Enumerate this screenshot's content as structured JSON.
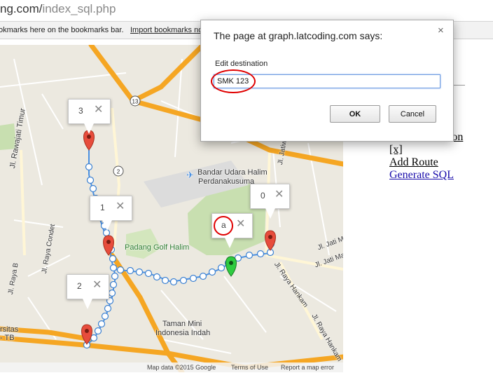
{
  "browser": {
    "url_domain": "ng.com/",
    "url_path": "index_sql.php",
    "bookmarks_message": "okmarks here on the bookmarks bar.",
    "import_link": "Import bookmarks no"
  },
  "map": {
    "markers": [
      {
        "label": "3",
        "color": "#e74c3c"
      },
      {
        "label": "1",
        "color": "#e74c3c"
      },
      {
        "label": "2",
        "color": "#e74c3c"
      },
      {
        "label": "0",
        "color": "#e74c3c"
      },
      {
        "label": "a",
        "color": "#2ecc40"
      }
    ],
    "route_shields": [
      "13",
      "2"
    ],
    "place_labels": {
      "road_rawajati": "Jl. Rawajati Timur",
      "airport_line1": "Bandar Udara Halim",
      "airport_line2": "Perdanakusuma",
      "jatiwaringin": "Jl. Jatiwaring",
      "golf": "Padang Golf Halim",
      "raya_condet": "Jl. Raya Condet",
      "raya_bogor": "Jl. Raya B",
      "jati_mak1": "Jl. Jati Mak",
      "jati_mak2": "Jl. Jati Mak",
      "raya_hankam1": "Jl. Raya Hankam",
      "raya_hankam2": "Jl. Raya Hankam",
      "tmii_line1": "Taman Mini",
      "tmii_line2": "Indonesia Indah",
      "rsitas_line1": "rsitas",
      "rsitas_line2": "- TB"
    },
    "footer": {
      "map_data": "Map data ©2015 Google",
      "terms": "Terms of Use",
      "report": "Report a map error"
    },
    "info_windows": [
      {
        "text": "3",
        "close": "✕"
      },
      {
        "text": "1",
        "close": "✕"
      },
      {
        "text": "2",
        "close": "✕"
      },
      {
        "text": "0",
        "close": "✕"
      },
      {
        "text": "a",
        "close": "✕"
      }
    ]
  },
  "sidebar": {
    "add_destination": "Add Destination",
    "remove": "[x]",
    "add_route": "Add Route",
    "generate_sql": "Generate SQL"
  },
  "dialog": {
    "title": "The page at graph.latcoding.com says:",
    "close": "×",
    "prompt": "Edit destination",
    "input_value": "SMK 123",
    "ok_label": "OK",
    "cancel_label": "Cancel"
  },
  "colors": {
    "map_background": "#ece9e0",
    "highway": "#f5a623",
    "route_dots": "#4a90e2",
    "park": "#c8dfb0",
    "annotation_circle": "#e00000",
    "link_blue": "#1a0dab"
  }
}
